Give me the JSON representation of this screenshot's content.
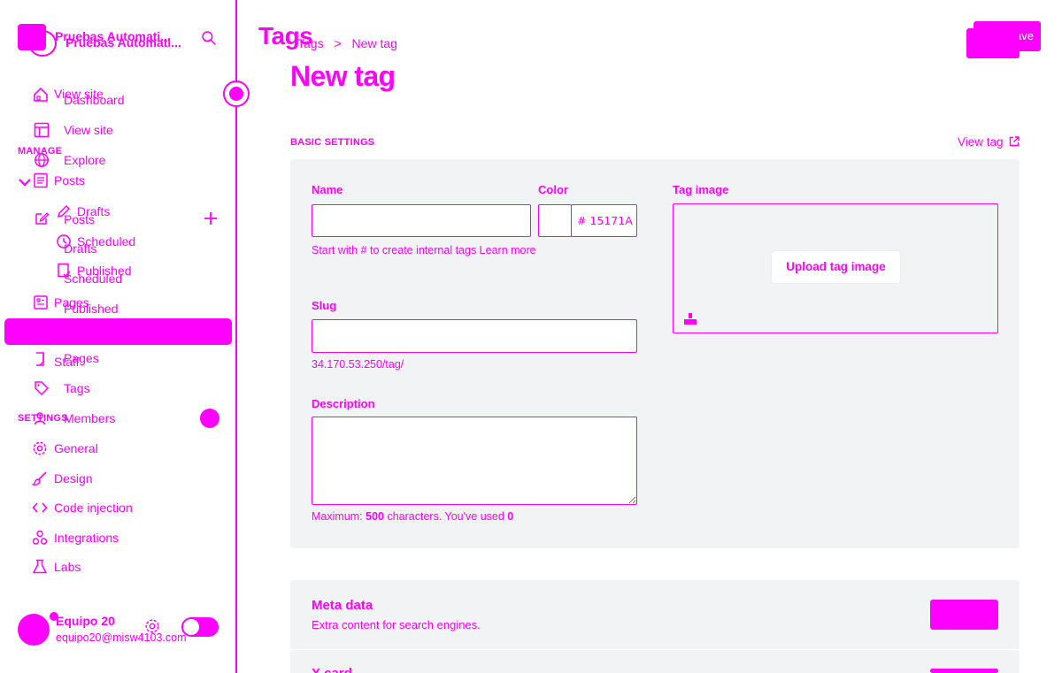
{
  "app": {
    "site_name": "Pruebas Automati..."
  },
  "sidebar": {
    "top_items": [
      {
        "label": "View site"
      },
      {
        "label": "Dashboard"
      },
      {
        "label": "View site"
      },
      {
        "label": "Explore"
      }
    ],
    "manage_heading": "MANAGE",
    "posts_label": "Posts",
    "drafts_label": "Drafts",
    "scheduled_label": "Scheduled",
    "published_label": "Published",
    "pages_label": "Pages",
    "staff_label": "Staff",
    "tags_label": "Tags",
    "members_label": "Members",
    "settings_heading": "SETTINGS",
    "overlap": {
      "posts": "Posts",
      "drafts": "Drafts",
      "scheduled": "Scheduled",
      "published": "Published",
      "pages": "Pages"
    },
    "settings_items": [
      {
        "label": "General"
      },
      {
        "label": "Design"
      },
      {
        "label": "Code injection"
      },
      {
        "label": "Integrations"
      },
      {
        "label": "Labs"
      }
    ],
    "user": {
      "name": "Equipo 20",
      "email": "equipo20@misw4103.com"
    }
  },
  "main": {
    "ghost_title": "Tags",
    "breadcrumb": {
      "parent": "Tags",
      "sep": ">",
      "current": "New tag"
    },
    "save_button": "Save",
    "page_title": "New tag",
    "basic_settings": "BASIC SETTINGS",
    "view_tag": "View tag",
    "form": {
      "name_label": "Name",
      "name_value": "",
      "name_help": "Start with # to create internal tags Learn more",
      "color_label": "Color",
      "color_value": "# 15171A",
      "slug_label": "Slug",
      "slug_value": "",
      "slug_help": "34.170.53.250/tag/",
      "description_label": "Description",
      "description_value": "",
      "desc_help_pre": "Maximum: ",
      "desc_help_max": "500",
      "desc_help_mid": " characters. You've used ",
      "desc_help_used": "0",
      "tag_image_label": "Tag image",
      "upload_button": "Upload tag image"
    },
    "meta": {
      "title": "Meta data",
      "subtitle": "Extra content for search engines."
    },
    "xcard": {
      "title": "X card"
    }
  }
}
